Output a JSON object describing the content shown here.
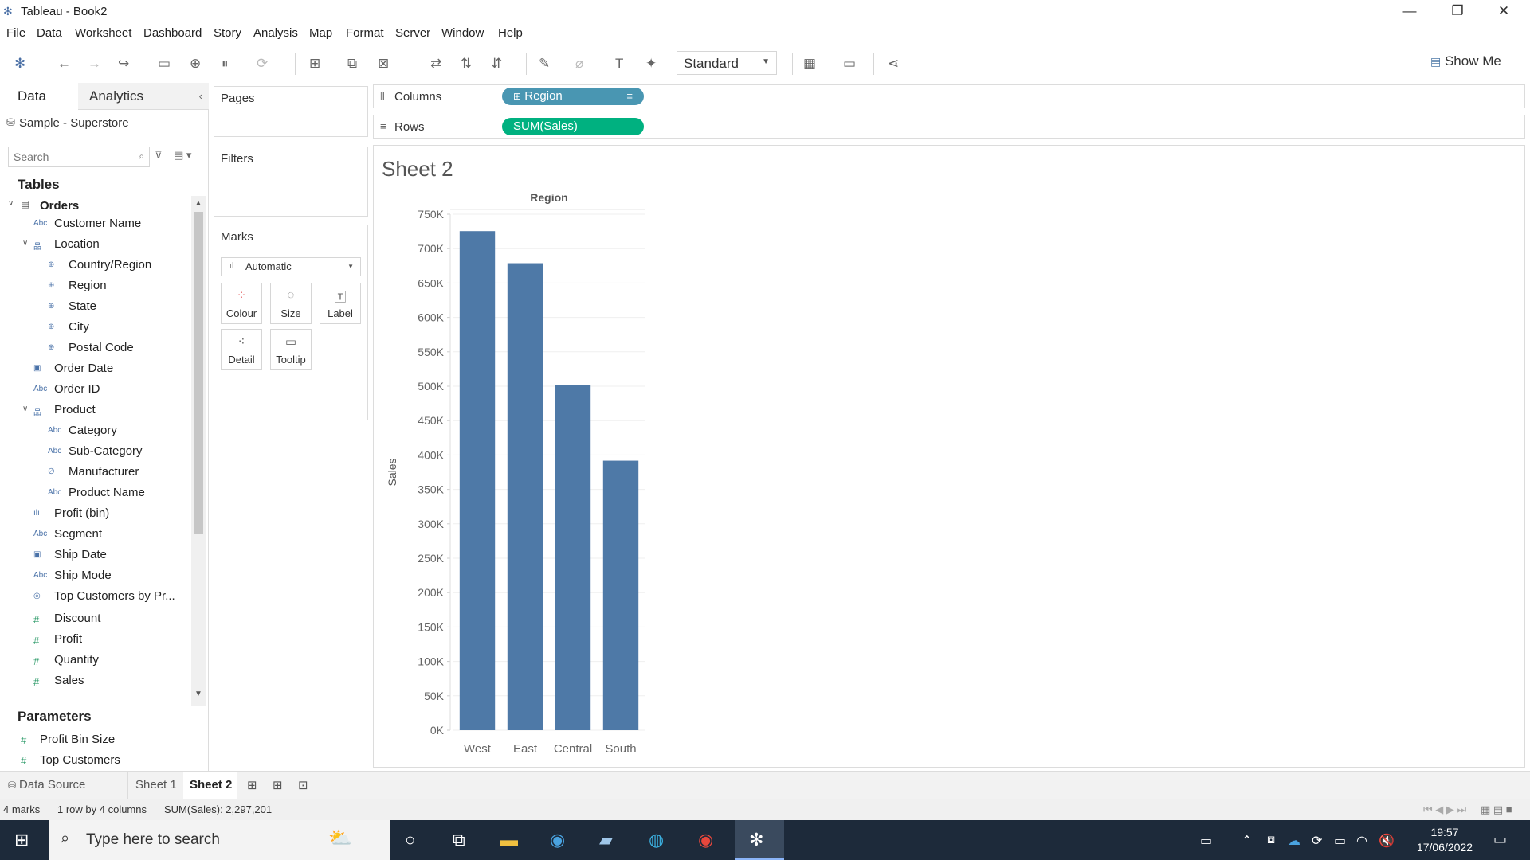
{
  "app": {
    "title": "Tableau - Book2"
  },
  "window_controls": {
    "minimize": "—",
    "restore": "❐",
    "close": "✕"
  },
  "menu": [
    "File",
    "Data",
    "Worksheet",
    "Dashboard",
    "Story",
    "Analysis",
    "Map",
    "Format",
    "Server",
    "Window",
    "Help"
  ],
  "toolbar": {
    "fit_value": "Standard",
    "show_me": "Show Me"
  },
  "data_pane": {
    "tabs": [
      "Data",
      "Analytics"
    ],
    "datasource": "Sample - Superstore",
    "search_placeholder": "Search",
    "tables_header": "Tables",
    "table_name": "Orders",
    "fields": [
      {
        "label": "Customer Name",
        "icon": "Abc",
        "kind": "dim",
        "level": 1
      },
      {
        "label": "Location",
        "icon": "hier",
        "kind": "dim",
        "level": 1,
        "expanded": true
      },
      {
        "label": "Country/Region",
        "icon": "globe",
        "kind": "dim",
        "level": 2
      },
      {
        "label": "Region",
        "icon": "globe",
        "kind": "dim",
        "level": 2
      },
      {
        "label": "State",
        "icon": "globe",
        "kind": "dim",
        "level": 2
      },
      {
        "label": "City",
        "icon": "globe",
        "kind": "dim",
        "level": 2
      },
      {
        "label": "Postal Code",
        "icon": "globe",
        "kind": "dim",
        "level": 2
      },
      {
        "label": "Order Date",
        "icon": "date",
        "kind": "dim",
        "level": 1
      },
      {
        "label": "Order ID",
        "icon": "Abc",
        "kind": "dim",
        "level": 1
      },
      {
        "label": "Product",
        "icon": "hier",
        "kind": "dim",
        "level": 1,
        "expanded": true
      },
      {
        "label": "Category",
        "icon": "Abc",
        "kind": "dim",
        "level": 2
      },
      {
        "label": "Sub-Category",
        "icon": "Abc",
        "kind": "dim",
        "level": 2
      },
      {
        "label": "Manufacturer",
        "icon": "clip",
        "kind": "dim",
        "level": 2
      },
      {
        "label": "Product Name",
        "icon": "Abc",
        "kind": "dim",
        "level": 2
      },
      {
        "label": "Profit (bin)",
        "icon": "bin",
        "kind": "dim",
        "level": 1
      },
      {
        "label": "Segment",
        "icon": "Abc",
        "kind": "dim",
        "level": 1
      },
      {
        "label": "Ship Date",
        "icon": "date",
        "kind": "dim",
        "level": 1
      },
      {
        "label": "Ship Mode",
        "icon": "Abc",
        "kind": "dim",
        "level": 1
      },
      {
        "label": "Top Customers by Pr...",
        "icon": "set",
        "kind": "dim",
        "level": 1
      },
      {
        "label": "Discount",
        "icon": "#",
        "kind": "mea",
        "level": 1
      },
      {
        "label": "Profit",
        "icon": "#",
        "kind": "mea",
        "level": 1
      },
      {
        "label": "Quantity",
        "icon": "#",
        "kind": "mea",
        "level": 1
      },
      {
        "label": "Sales",
        "icon": "#",
        "kind": "mea",
        "level": 1
      }
    ],
    "parameters_header": "Parameters",
    "parameters": [
      "Profit Bin Size",
      "Top Customers"
    ]
  },
  "shelves": {
    "pages": "Pages",
    "filters": "Filters",
    "marks": "Marks",
    "mark_type": "Automatic",
    "mark_cards": [
      "Colour",
      "Size",
      "Label",
      "Detail",
      "Tooltip"
    ],
    "columns_label": "Columns",
    "rows_label": "Rows",
    "columns_pill": "Region",
    "rows_pill": "SUM(Sales)",
    "dim_color": "#4996b2",
    "mea_color": "#00b180"
  },
  "sheet": {
    "title": "Sheet 2"
  },
  "chart_data": {
    "type": "bar",
    "title": "Region",
    "categories": [
      "West",
      "East",
      "Central",
      "South"
    ],
    "values": [
      725458,
      678781,
      501240,
      391722
    ],
    "ylabel": "Sales",
    "ylim": [
      0,
      750000
    ],
    "ytick_labels": [
      "0K",
      "50K",
      "100K",
      "150K",
      "200K",
      "250K",
      "300K",
      "350K",
      "400K",
      "450K",
      "500K",
      "550K",
      "600K",
      "650K",
      "700K",
      "750K"
    ],
    "bar_color": "#4e79a7",
    "grid": true
  },
  "sheet_tabs": [
    "Data Source",
    "Sheet 1",
    "Sheet 2"
  ],
  "active_tab": "Sheet 2",
  "status": {
    "marks": "4 marks",
    "layout": "1 row by 4 columns",
    "sum": "SUM(Sales): 2,297,201"
  },
  "taskbar": {
    "search_placeholder": "Type here to search",
    "time": "19:57",
    "date": "17/06/2022"
  }
}
